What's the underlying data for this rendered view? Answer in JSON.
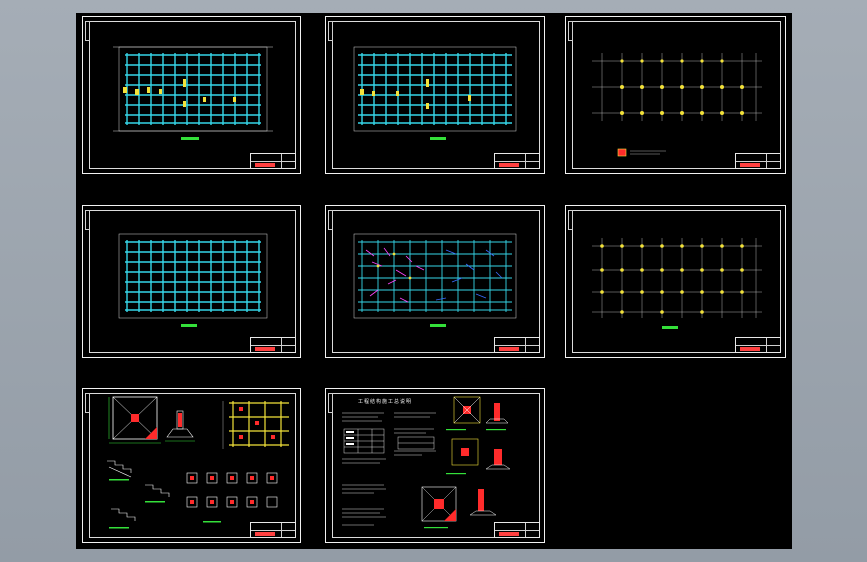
{
  "drawing_set": {
    "sheet_count": 8,
    "notes_sheet_title": "工程结构施工总说明"
  },
  "colors": {
    "background": "#000000",
    "border": "#f2f2f2",
    "grid": "#36d6e7",
    "axis": "#d9d9d9",
    "column": "#f3e23a",
    "rebar_red": "#ff2b2b",
    "annotation_green": "#34e03a",
    "detail_magenta": "#ff44ff",
    "detail_blue": "#3a6cff"
  },
  "icons": [
    "grid-plan",
    "column-layout",
    "foundation-detail",
    "notes-text"
  ]
}
